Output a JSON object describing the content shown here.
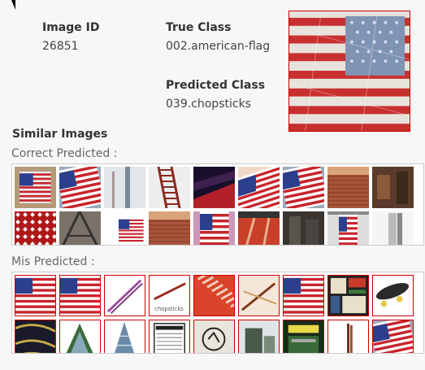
{
  "info": {
    "image_id_label": "Image ID",
    "image_id_value": "26851",
    "true_class_label": "True Class",
    "true_class_value": "002.american-flag",
    "predicted_class_label": "Predicted Class",
    "predicted_class_value": "039.chopsticks"
  },
  "similar": {
    "title": "Similar Images",
    "correct_label": "Correct Predicted :",
    "mis_label": "Mis Predicted :"
  },
  "main_image": {
    "kind": "flag-pattern"
  },
  "correct_thumbs": [
    {
      "kind": "flag-wall"
    },
    {
      "kind": "flag-wave"
    },
    {
      "kind": "pole"
    },
    {
      "kind": "ladder"
    },
    {
      "kind": "dark-red"
    },
    {
      "kind": "flag-slant"
    },
    {
      "kind": "flag-wave"
    },
    {
      "kind": "brick"
    },
    {
      "kind": "brick-dark"
    },
    {
      "kind": "red-grid"
    },
    {
      "kind": "structure"
    },
    {
      "kind": "flag-small"
    },
    {
      "kind": "brick"
    },
    {
      "kind": "flag-stack"
    },
    {
      "kind": "red-long"
    },
    {
      "kind": "dark-building"
    },
    {
      "kind": "flag-hang"
    },
    {
      "kind": "grey-pole"
    }
  ],
  "mis_thumbs": [
    {
      "kind": "flag"
    },
    {
      "kind": "flag"
    },
    {
      "kind": "sticks-purple"
    },
    {
      "kind": "sticks-red"
    },
    {
      "kind": "red-ladder"
    },
    {
      "kind": "sticks-cross"
    },
    {
      "kind": "flag"
    },
    {
      "kind": "stained-glass"
    },
    {
      "kind": "skateboard"
    },
    {
      "kind": "dark-pattern"
    },
    {
      "kind": "tree"
    },
    {
      "kind": "tower"
    },
    {
      "kind": "label"
    },
    {
      "kind": "logo"
    },
    {
      "kind": "building"
    },
    {
      "kind": "book"
    },
    {
      "kind": "sticks-single"
    },
    {
      "kind": "flag-wave"
    }
  ]
}
